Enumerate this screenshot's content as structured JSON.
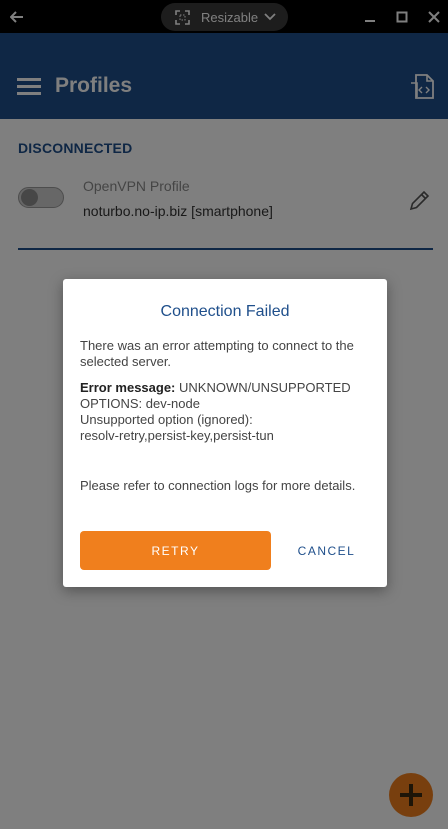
{
  "window": {
    "resize_label": "Resizable",
    "icons": {
      "back": "arrow-left-icon",
      "resize": "resize-frame-icon",
      "dropdown": "chevron-down-icon",
      "minimize": "minimize-icon",
      "maximize": "maximize-icon",
      "close": "close-icon"
    }
  },
  "appbar": {
    "title": "Profiles",
    "icons": {
      "menu": "hamburger-menu-icon",
      "import": "import-file-icon"
    }
  },
  "profiles": {
    "status_header": "DISCONNECTED",
    "items": [
      {
        "name": "OpenVPN Profile",
        "server": "noturbo.no-ip.biz [smartphone]",
        "enabled": false
      }
    ]
  },
  "dialog": {
    "title": "Connection Failed",
    "intro": "There was an error attempting to connect to the selected server.",
    "error_label": "Error message:",
    "error_text": " UNKNOWN/UNSUPPORTED OPTIONS: dev-node",
    "error_detail_1": "Unsupported option (ignored):",
    "error_detail_2": "resolv-retry,persist-key,persist-tun",
    "footer": "Please refer to connection logs for more details.",
    "retry_label": "RETRY",
    "cancel_label": "CANCEL"
  },
  "colors": {
    "primary": "#1f4f8b",
    "accent": "#f07f1d",
    "titlebar": "#000000"
  }
}
